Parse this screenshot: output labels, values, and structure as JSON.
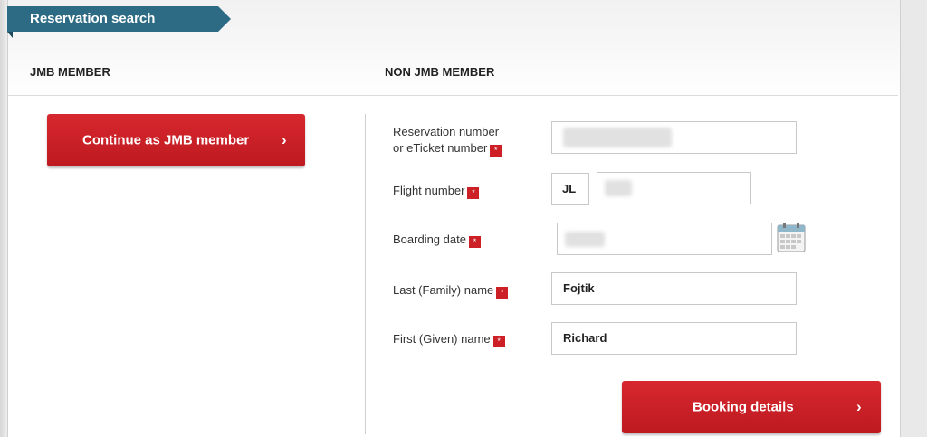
{
  "header": {
    "title": "Reservation search"
  },
  "columns": {
    "jmb": "JMB MEMBER",
    "non_jmb": "NON JMB MEMBER"
  },
  "jmb_button": {
    "label": "Continue as JMB member",
    "chevron": "›"
  },
  "form": {
    "required_mark": "*",
    "reservation": {
      "label_line1": "Reservation number",
      "label_line2": "or eTicket number",
      "value": ""
    },
    "flight": {
      "label": "Flight number",
      "prefix": "JL",
      "value": ""
    },
    "boarding_date": {
      "label": "Boarding date",
      "value": ""
    },
    "last_name": {
      "label": "Last (Family) name",
      "value": "Fojtik"
    },
    "first_name": {
      "label": "First (Given) name",
      "value": "Richard"
    }
  },
  "booking_button": {
    "label": "Booking details",
    "chevron": "›"
  },
  "colors": {
    "brand_red": "#cc1f26",
    "ribbon_blue": "#2d6b84"
  },
  "icons": {
    "calendar": "calendar-icon",
    "chevron": "chevron-right-icon"
  }
}
